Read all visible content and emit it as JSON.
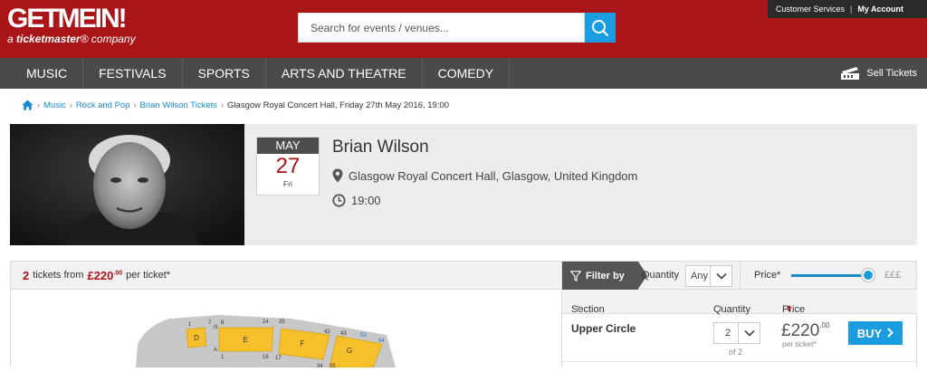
{
  "header": {
    "logo_part1": "GET",
    "logo_part2": "ME",
    "logo_part3": "IN!",
    "logo_sub_prefix": "a ",
    "logo_sub_brand": "ticketmaster",
    "logo_sub_suffix": "® company",
    "search_placeholder": "Search for events / venues...",
    "customer_services": "Customer Services",
    "separator": "|",
    "my_account": "My Account"
  },
  "nav": {
    "items": [
      "MUSIC",
      "FESTIVALS",
      "SPORTS",
      "ARTS AND THEATRE",
      "COMEDY"
    ],
    "sell_tickets": "Sell Tickets"
  },
  "breadcrumb": {
    "items": [
      "Music",
      "Rock and Pop",
      "Brian Wilson Tickets"
    ],
    "current": "Glasgow Royal Concert Hall, Friday 27th May 2016, 19:00"
  },
  "event": {
    "month": "MAY",
    "day": "27",
    "weekday": "Fri",
    "title": "Brian Wilson",
    "venue": "Glasgow Royal Concert Hall, Glasgow, United Kingdom",
    "time": "19:00"
  },
  "tickets": {
    "count": "2",
    "from_text": "tickets from",
    "price_main": "£220",
    "price_pence": ".00",
    "per_ticket": "per ticket*"
  },
  "filter": {
    "filter_by": "Filter by",
    "quantity_label": "Quantity",
    "quantity_value": "Any",
    "price_label": "Price*",
    "price_range_label": "£££",
    "slider_level": 1.0
  },
  "listing": {
    "headers": {
      "section": "Section",
      "quantity": "Quantity",
      "price": "Price"
    },
    "rows": [
      {
        "section": "Upper Circle",
        "quantity": "2",
        "of_text": "of 2",
        "price_main": "£220",
        "price_pence": ".00",
        "per_ticket": "per ticket*",
        "buy": "BUY"
      }
    ]
  },
  "seatmap": {
    "blocks": [
      "D",
      "E",
      "F",
      "G"
    ],
    "row_labels": [
      "1",
      "7",
      "G",
      "8",
      "24",
      "25",
      "42",
      "43",
      "53",
      "54",
      "A",
      "1",
      "16",
      "17",
      "34",
      "35"
    ]
  },
  "colors": {
    "brand_red": "#a91518",
    "nav_gray": "#4a4a4a",
    "accent_blue": "#1a9de0",
    "seat_yellow": "#f5c02a"
  }
}
